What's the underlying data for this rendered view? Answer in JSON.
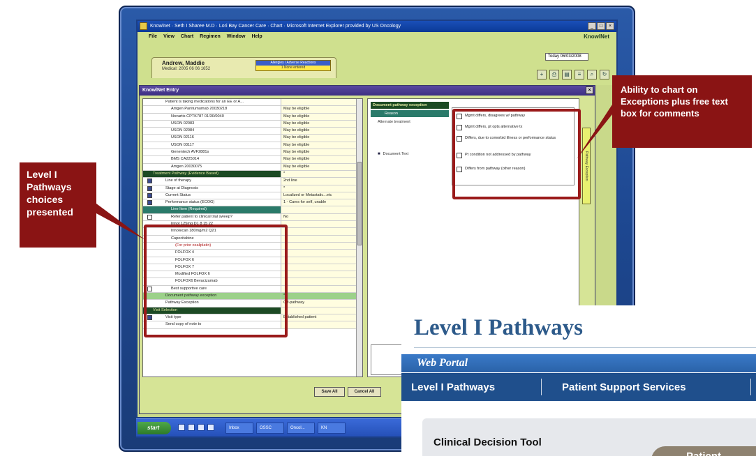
{
  "app": {
    "title": "Knowlnet · Seth I Sharee M.D · Lori Bay Cancer Care · Chart · Microsoft Internet Explorer provided by US Oncology",
    "brand": "KnowlNet",
    "menu": [
      "File",
      "View",
      "Chart",
      "Regimen",
      "Window",
      "Help"
    ],
    "date_value": "Today 06/03/2008"
  },
  "patient": {
    "name": "Andrew, Maddie",
    "mrn": "Medical: 2005 06 06 1652",
    "allergy_header": "Allergies / Adverse Reactions",
    "allergy_value": "1     None entered"
  },
  "dialog": {
    "title": "KnowlNet Entry",
    "rows": [
      {
        "label": "Patient is taking medications for an EE or A...",
        "value": "",
        "type": "plain"
      },
      {
        "label": "Amgen Panitumumab 20030218",
        "value": "May be eligible",
        "type": "ind"
      },
      {
        "label": "Novartis CPTK787 01/30/0040",
        "value": "May be eligible",
        "type": "ind"
      },
      {
        "label": "USON 02083",
        "value": "May be eligible",
        "type": "ind"
      },
      {
        "label": "USON 02084",
        "value": "May be eligible",
        "type": "ind"
      },
      {
        "label": "USON 02116",
        "value": "May be eligible",
        "type": "ind"
      },
      {
        "label": "USON 03117",
        "value": "May be eligible",
        "type": "ind"
      },
      {
        "label": "Genentech AVF2881s",
        "value": "May be eligible",
        "type": "ind"
      },
      {
        "label": "BMS CA225014",
        "value": "May be eligible",
        "type": "ind"
      },
      {
        "label": "Amgen 20030075",
        "value": "May be eligible",
        "type": "ind"
      },
      {
        "label": "Treatment Pathway (Evidence Based)",
        "value": "*",
        "type": "section"
      },
      {
        "label": "Line of therapy",
        "value": "2nd line",
        "type": "chk"
      },
      {
        "label": "Stage at Diagnosis",
        "value": "*",
        "type": "chk"
      },
      {
        "label": "Current Status",
        "value": "Localized or Metastatic...etc",
        "type": "chk"
      },
      {
        "label": "Performance status (ECOG)",
        "value": "1 - Cares for self, unable",
        "type": "chk"
      },
      {
        "label": "Line Item (Required)",
        "value": "",
        "type": "section2"
      },
      {
        "label": "Refer patient to clinical trial sweep?",
        "value": "No",
        "type": "chk-ind"
      },
      {
        "label": "Irinot 125mg D1 8 15 22",
        "value": "",
        "type": "ind"
      },
      {
        "label": "Irinotecan 180mg/m2 Q21",
        "value": "",
        "type": "ind"
      },
      {
        "label": "Capecitabine",
        "value": "",
        "type": "ind"
      },
      {
        "label": "(For prior oxaliplatin)",
        "value": "",
        "type": "red"
      },
      {
        "label": "FOLFOX 4",
        "value": "",
        "type": "ind2"
      },
      {
        "label": "FOLFOX 6",
        "value": "",
        "type": "ind2"
      },
      {
        "label": "FOLFOX 7",
        "value": "",
        "type": "ind2"
      },
      {
        "label": "Modified FOLFOX 6",
        "value": "",
        "type": "ind2"
      },
      {
        "label": "FOLFOX6 Bevacizumab",
        "value": "",
        "type": "ind2"
      },
      {
        "label": "Best supportive care",
        "value": "",
        "type": "chk-ind"
      },
      {
        "label": "Document pathway exception",
        "value": "*",
        "type": "highlight"
      },
      {
        "label": "Pathway Exception",
        "value": "Off-pathway",
        "type": "plain"
      },
      {
        "label": "Visit Selection",
        "value": "",
        "type": "section"
      },
      {
        "label": "Visit type",
        "value": "Established patient",
        "type": "chk"
      },
      {
        "label": "Send copy of note to",
        "value": "",
        "type": "plain"
      }
    ],
    "right": {
      "title": "Document pathway exception",
      "col_header": "Reason",
      "reason_value": "Alternate treatment",
      "doc_text": "Document Text",
      "options": [
        "Mgmt differs, disagrees w/ pathway",
        "Mgmt differs, pt opts alternative tx",
        "Differs, due to comorbid illness or performance status",
        "Pt condition not addressed by pathway",
        "Differs from pathway (other reason)"
      ],
      "side_tab": "Pathway Exception"
    },
    "save_label": "Save All",
    "cancel_label": "Cancel All"
  },
  "taskbar": {
    "start": "start",
    "items": [
      "Inbox",
      "OSSC",
      "Oncol...",
      "KN"
    ]
  },
  "callouts": {
    "left": "Level I Pathways choices presented",
    "right": "Ability to chart on Exceptions plus free text box for comments"
  },
  "portal": {
    "title": "Level I Pathways",
    "web_title": "Web Portal",
    "nav": [
      "Level I Pathways",
      "Patient Support Services"
    ],
    "panel_title": "Clinical Decision Tool",
    "pill": "Patient"
  },
  "colors": {
    "callout_red": "#8a1414",
    "portal_blue": "#1f4f8c",
    "app_green": "#c9d98a"
  }
}
